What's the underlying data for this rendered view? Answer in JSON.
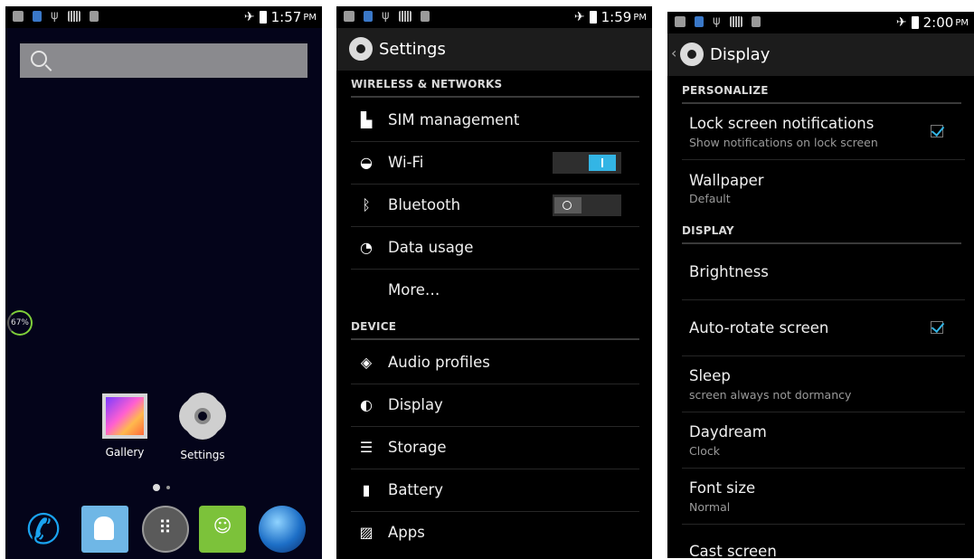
{
  "screen1": {
    "status_time": "1:57",
    "status_ampm": "PM",
    "memory_percent": "67%",
    "apps": [
      {
        "label": "Gallery",
        "icon": "gallery-icon"
      },
      {
        "label": "Settings",
        "icon": "settings-gear-icon"
      }
    ],
    "dock": [
      "phone-icon",
      "contacts-icon",
      "app-drawer-icon",
      "messaging-icon",
      "browser-globe-icon"
    ]
  },
  "screen2": {
    "status_time": "1:59",
    "status_ampm": "PM",
    "title": "Settings",
    "sections": {
      "wireless": "WIRELESS & NETWORKS",
      "device": "DEVICE"
    },
    "items": {
      "sim": "SIM management",
      "wifi": "Wi-Fi",
      "bluetooth": "Bluetooth",
      "data_usage": "Data usage",
      "more": "More…",
      "audio": "Audio profiles",
      "display": "Display",
      "storage": "Storage",
      "battery": "Battery",
      "apps": "Apps"
    },
    "wifi_on": true,
    "bluetooth_on": false
  },
  "screen3": {
    "status_time": "2:00",
    "status_ampm": "PM",
    "title": "Display",
    "sections": {
      "personalize": "PERSONALIZE",
      "display": "DISPLAY"
    },
    "items": {
      "lock_title": "Lock screen notifications",
      "lock_sub": "Show notifications on lock screen",
      "wallpaper_title": "Wallpaper",
      "wallpaper_sub": "Default",
      "brightness_title": "Brightness",
      "autorotate_title": "Auto-rotate screen",
      "sleep_title": "Sleep",
      "sleep_sub": "screen always not dormancy",
      "daydream_title": "Daydream",
      "daydream_sub": "Clock",
      "fontsize_title": "Font size",
      "fontsize_sub": "Normal",
      "cast_title": "Cast screen"
    },
    "lock_checked": true,
    "autorotate_checked": true
  },
  "colors": {
    "accent": "#33b5e5",
    "background": "#000000",
    "home_background": "#04041a",
    "actionbar": "#1c1c1c"
  }
}
